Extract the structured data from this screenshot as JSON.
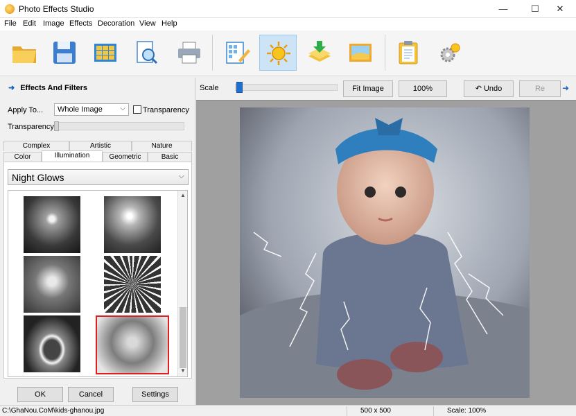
{
  "window": {
    "title": "Photo Effects Studio",
    "controls": [
      "—",
      "☐",
      "✕"
    ]
  },
  "menu": [
    "File",
    "Edit",
    "Image",
    "Effects",
    "Decoration",
    "View",
    "Help"
  ],
  "toolbar": {
    "buttons": [
      "open-folder",
      "save-disk",
      "grid-layout",
      "preview-zoom",
      "print",
      "grid-edit",
      "sun-effects",
      "layers-import",
      "landscape-image",
      "clipboard",
      "settings-gear"
    ],
    "active": "sun-effects"
  },
  "left": {
    "header": "Effects And Filters",
    "apply_to_label": "Apply To...",
    "apply_to_value": "Whole Image",
    "transparency_check_label": "Transparency",
    "transparency_label": "Transparency",
    "tabs_row1": [
      "Complex",
      "Artistic",
      "Nature"
    ],
    "tabs_row2": [
      "Color",
      "Illumination",
      "Geometric",
      "Basic"
    ],
    "selected_tab": "Illumination",
    "effect": "Night Glows",
    "buttons": {
      "ok": "OK",
      "cancel": "Cancel",
      "settings": "Settings"
    }
  },
  "right": {
    "scale_label": "Scale",
    "fit_label": "Fit Image",
    "zoom_label": "100%",
    "undo_label": "Undo",
    "redo_label": "Re"
  },
  "status": {
    "path": "C:\\GhaNou.CoM\\kids-ghanou.jpg",
    "size": "500 x 500",
    "scale": "Scale: 100%"
  }
}
